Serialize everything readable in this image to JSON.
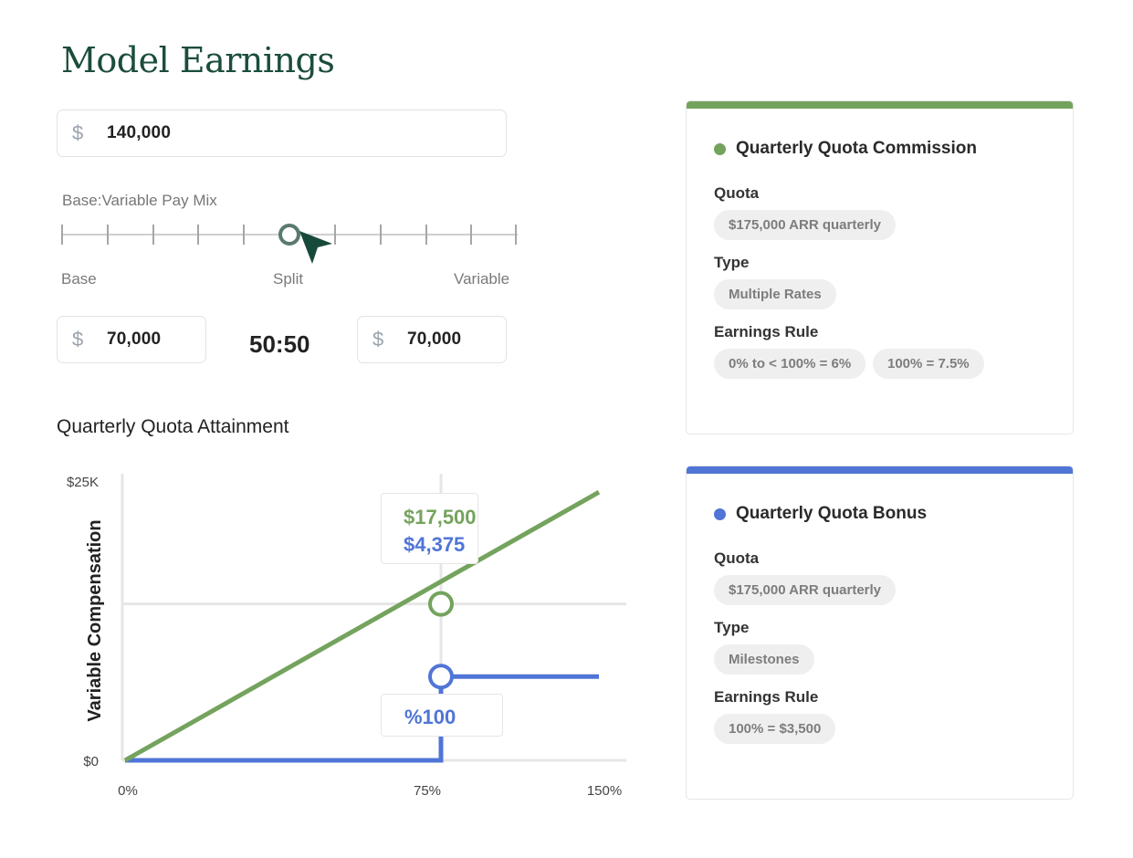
{
  "title": "Model Earnings",
  "salary_input": {
    "currency": "$",
    "value": "140,000"
  },
  "pay_mix": {
    "label": "Base:Variable Pay Mix",
    "labels": {
      "base": "Base",
      "split": "Split",
      "variable": "Variable"
    },
    "base_input": {
      "currency": "$",
      "value": "70,000"
    },
    "variable_input": {
      "currency": "$",
      "value": "70,000"
    },
    "ratio": "50:50"
  },
  "chart_section": {
    "title": "Quarterly Quota Attainment",
    "callout": {
      "commission_value": "$17,500",
      "bonus_value": "$4,375",
      "attainment_label": "%100"
    }
  },
  "chart_data": {
    "type": "line",
    "ylabel": "Variable Compensation",
    "xlabel": "",
    "x_ticks": [
      "0%",
      "75%",
      "150%"
    ],
    "y_ticks": [
      "$0",
      "$25K"
    ],
    "xlim": [
      0,
      150
    ],
    "ylim": [
      0,
      25000
    ],
    "series": [
      {
        "color": "#74a35d",
        "x": [
          0,
          150
        ],
        "y": [
          0,
          24000
        ]
      },
      {
        "color": "#5075d6",
        "x": [
          0,
          100,
          100,
          150
        ],
        "y": [
          0,
          0,
          7500,
          7500
        ]
      }
    ],
    "highlight_points": [
      {
        "series": 0,
        "x": 100,
        "y": 14000
      },
      {
        "series": 1,
        "x": 100,
        "y": 7500
      }
    ],
    "grid": true
  },
  "cards": [
    {
      "title": "Quarterly Quota Commission",
      "color": "#74a35d",
      "quota_label": "Quota",
      "quota": "$175,000 ARR quarterly",
      "type_label": "Type",
      "type": "Multiple Rates",
      "rule_label": "Earnings Rule",
      "rules": [
        "0% to < 100% = 6%",
        "100% = 7.5%"
      ]
    },
    {
      "title": "Quarterly Quota Bonus",
      "color": "#5075d6",
      "quota_label": "Quota",
      "quota": "$175,000 ARR quarterly",
      "type_label": "Type",
      "type": "Milestones",
      "rule_label": "Earnings Rule",
      "rules": [
        "100% = $3,500"
      ]
    }
  ]
}
